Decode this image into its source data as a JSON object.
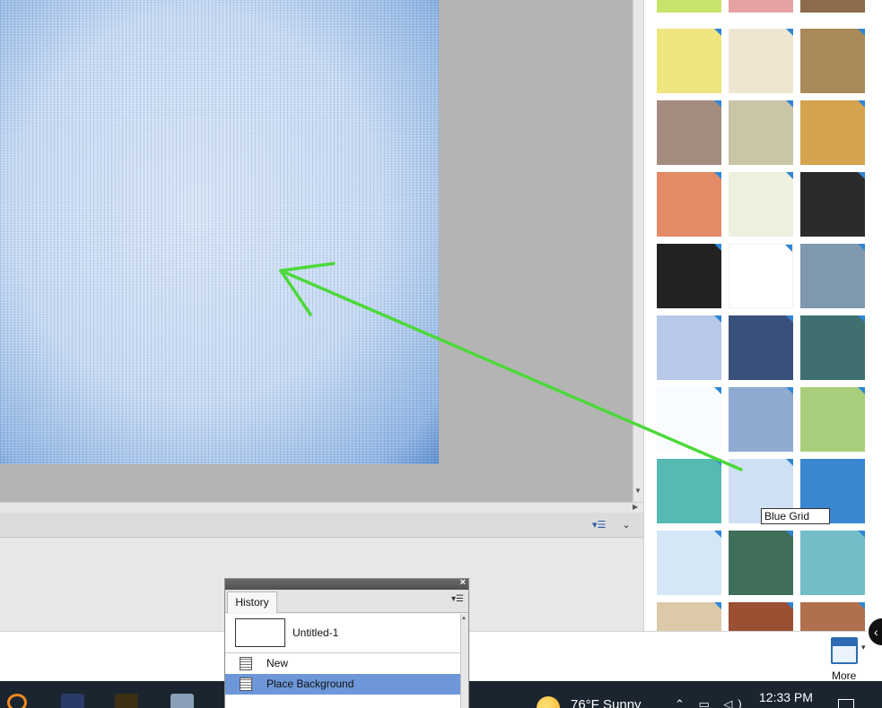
{
  "graphics_panel": {
    "thumbnails": [
      {
        "name": "thumb-lime",
        "color": "#c9e46a"
      },
      {
        "name": "thumb-pink-animal",
        "color": "#e6a2a2"
      },
      {
        "name": "thumb-brown-animal",
        "color": "#8d6b4c"
      },
      {
        "name": "thumb-yellow-bubbles",
        "color": "#eee57e"
      },
      {
        "name": "thumb-cream-bear",
        "color": "#efe6d2"
      },
      {
        "name": "thumb-parchment",
        "color": "#a88a5a"
      },
      {
        "name": "thumb-taupe",
        "color": "#a48b80"
      },
      {
        "name": "thumb-sage",
        "color": "#c9c6a8"
      },
      {
        "name": "thumb-polka-dots",
        "color": "#d3a34f"
      },
      {
        "name": "thumb-orange-bokeh",
        "color": "#e38a66"
      },
      {
        "name": "thumb-stripes-dino",
        "color": "#eef0df"
      },
      {
        "name": "thumb-dark-plaid",
        "color": "#2b2b2b"
      },
      {
        "name": "thumb-black",
        "color": "#222222"
      },
      {
        "name": "thumb-white",
        "color": "#ffffff"
      },
      {
        "name": "thumb-slate-grunge",
        "color": "#7f98ad"
      },
      {
        "name": "thumb-pastel-stripes",
        "color": "#b7c8e8"
      },
      {
        "name": "thumb-navy-brick",
        "color": "#39507a"
      },
      {
        "name": "thumb-teal-texture",
        "color": "#3f6f6f"
      },
      {
        "name": "thumb-white-sparkle",
        "color": "#f9fcff"
      },
      {
        "name": "thumb-blue-stripes",
        "color": "#8eaad0"
      },
      {
        "name": "thumb-green-stripes",
        "color": "#a9cf7d"
      },
      {
        "name": "thumb-green-blue-stripes",
        "color": "#56b9b2"
      },
      {
        "name": "thumb-blue-grid",
        "color": "#cfe0f5"
      },
      {
        "name": "thumb-bright-blue",
        "color": "#3a86cf"
      },
      {
        "name": "thumb-light-blue-check",
        "color": "#d5e6f7"
      },
      {
        "name": "thumb-green-grunge",
        "color": "#3f6e59"
      },
      {
        "name": "thumb-aqua-grunge",
        "color": "#72bdc7"
      },
      {
        "name": "thumb-beige-wood",
        "color": "#dcc9a8"
      },
      {
        "name": "thumb-red-brick",
        "color": "#9b4f33"
      },
      {
        "name": "thumb-clay",
        "color": "#b0704e"
      }
    ],
    "tooltip": "Blue Grid"
  },
  "history": {
    "tab_label": "History",
    "snapshot_label": "Untitled-1",
    "steps": [
      "New",
      "Place Background"
    ]
  },
  "bottom": {
    "more_label": "More"
  },
  "taskbar": {
    "weather": "76°F  Sunny",
    "clock": "12:33 PM"
  },
  "colors": {
    "accent": "#6d97d8",
    "arrow": "#4cd93a"
  }
}
